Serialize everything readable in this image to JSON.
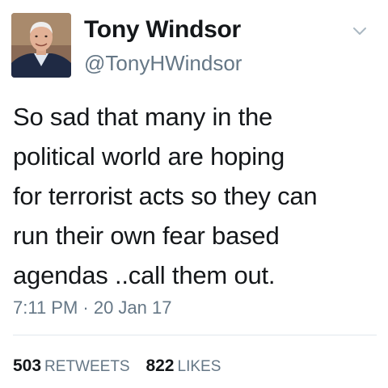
{
  "tweet": {
    "author": {
      "name": "Tony Windsor",
      "handle": "@TonyHWindsor",
      "avatar_icon": "profile-photo"
    },
    "text_lines": [
      "So sad that many in the",
      "political world are hoping",
      "for terrorist acts so they can",
      "run their own fear based",
      "agendas ..call them out."
    ],
    "timestamp": "7:11 PM · 20 Jan 17",
    "stats": {
      "retweets_count": "503",
      "retweets_label": "RETWEETS",
      "likes_count": "822",
      "likes_label": "LIKES"
    },
    "menu_icon": "chevron-down-icon"
  },
  "colors": {
    "text": "#14171a",
    "secondary": "#657786",
    "divider": "#e1e8ed"
  }
}
